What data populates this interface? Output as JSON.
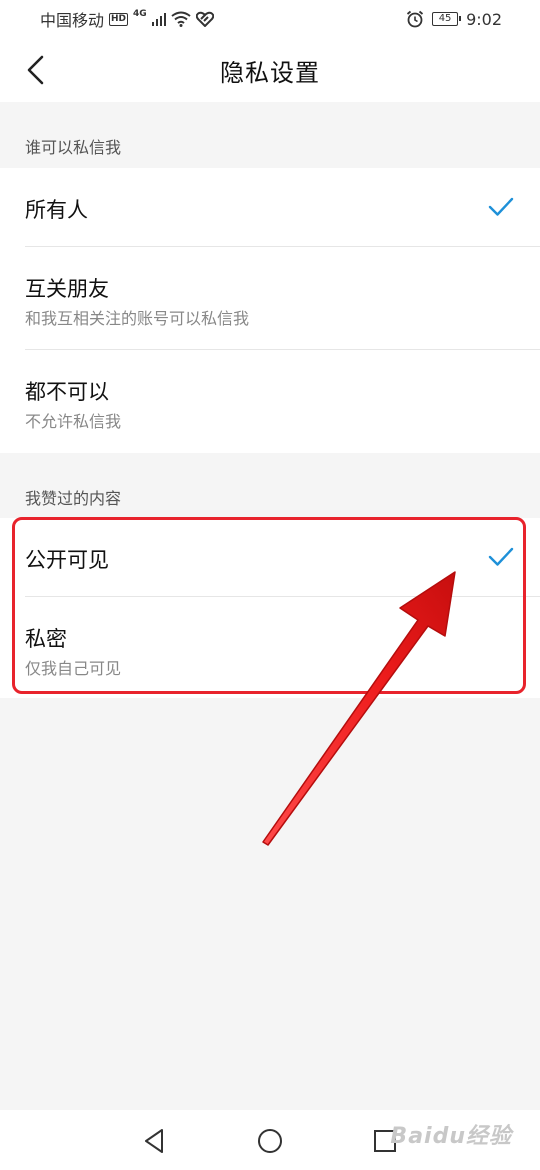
{
  "status_bar": {
    "carrier": "中国移动",
    "hd": "HD",
    "network": "4G",
    "battery": "45",
    "time": "9:02"
  },
  "header": {
    "title": "隐私设置"
  },
  "section_dm": {
    "label": "谁可以私信我",
    "items": [
      {
        "title": "所有人",
        "subtitle": "",
        "selected": true
      },
      {
        "title": "互关朋友",
        "subtitle": "和我互相关注的账号可以私信我",
        "selected": false
      },
      {
        "title": "都不可以",
        "subtitle": "不允许私信我",
        "selected": false
      }
    ]
  },
  "section_likes": {
    "label": "我赞过的内容",
    "items": [
      {
        "title": "公开可见",
        "subtitle": "",
        "selected": true
      },
      {
        "title": "私密",
        "subtitle": "仅我自己可见",
        "selected": false
      }
    ]
  },
  "colors": {
    "accent_check": "#1e90d8",
    "annotation_red": "#e8232c"
  },
  "icons": {
    "back": "chevron-left-icon",
    "check": "checkmark-icon",
    "nav_back": "triangle-back-icon",
    "nav_home": "circle-home-icon",
    "nav_recent": "square-recent-icon"
  },
  "watermark": "Baidu经验"
}
